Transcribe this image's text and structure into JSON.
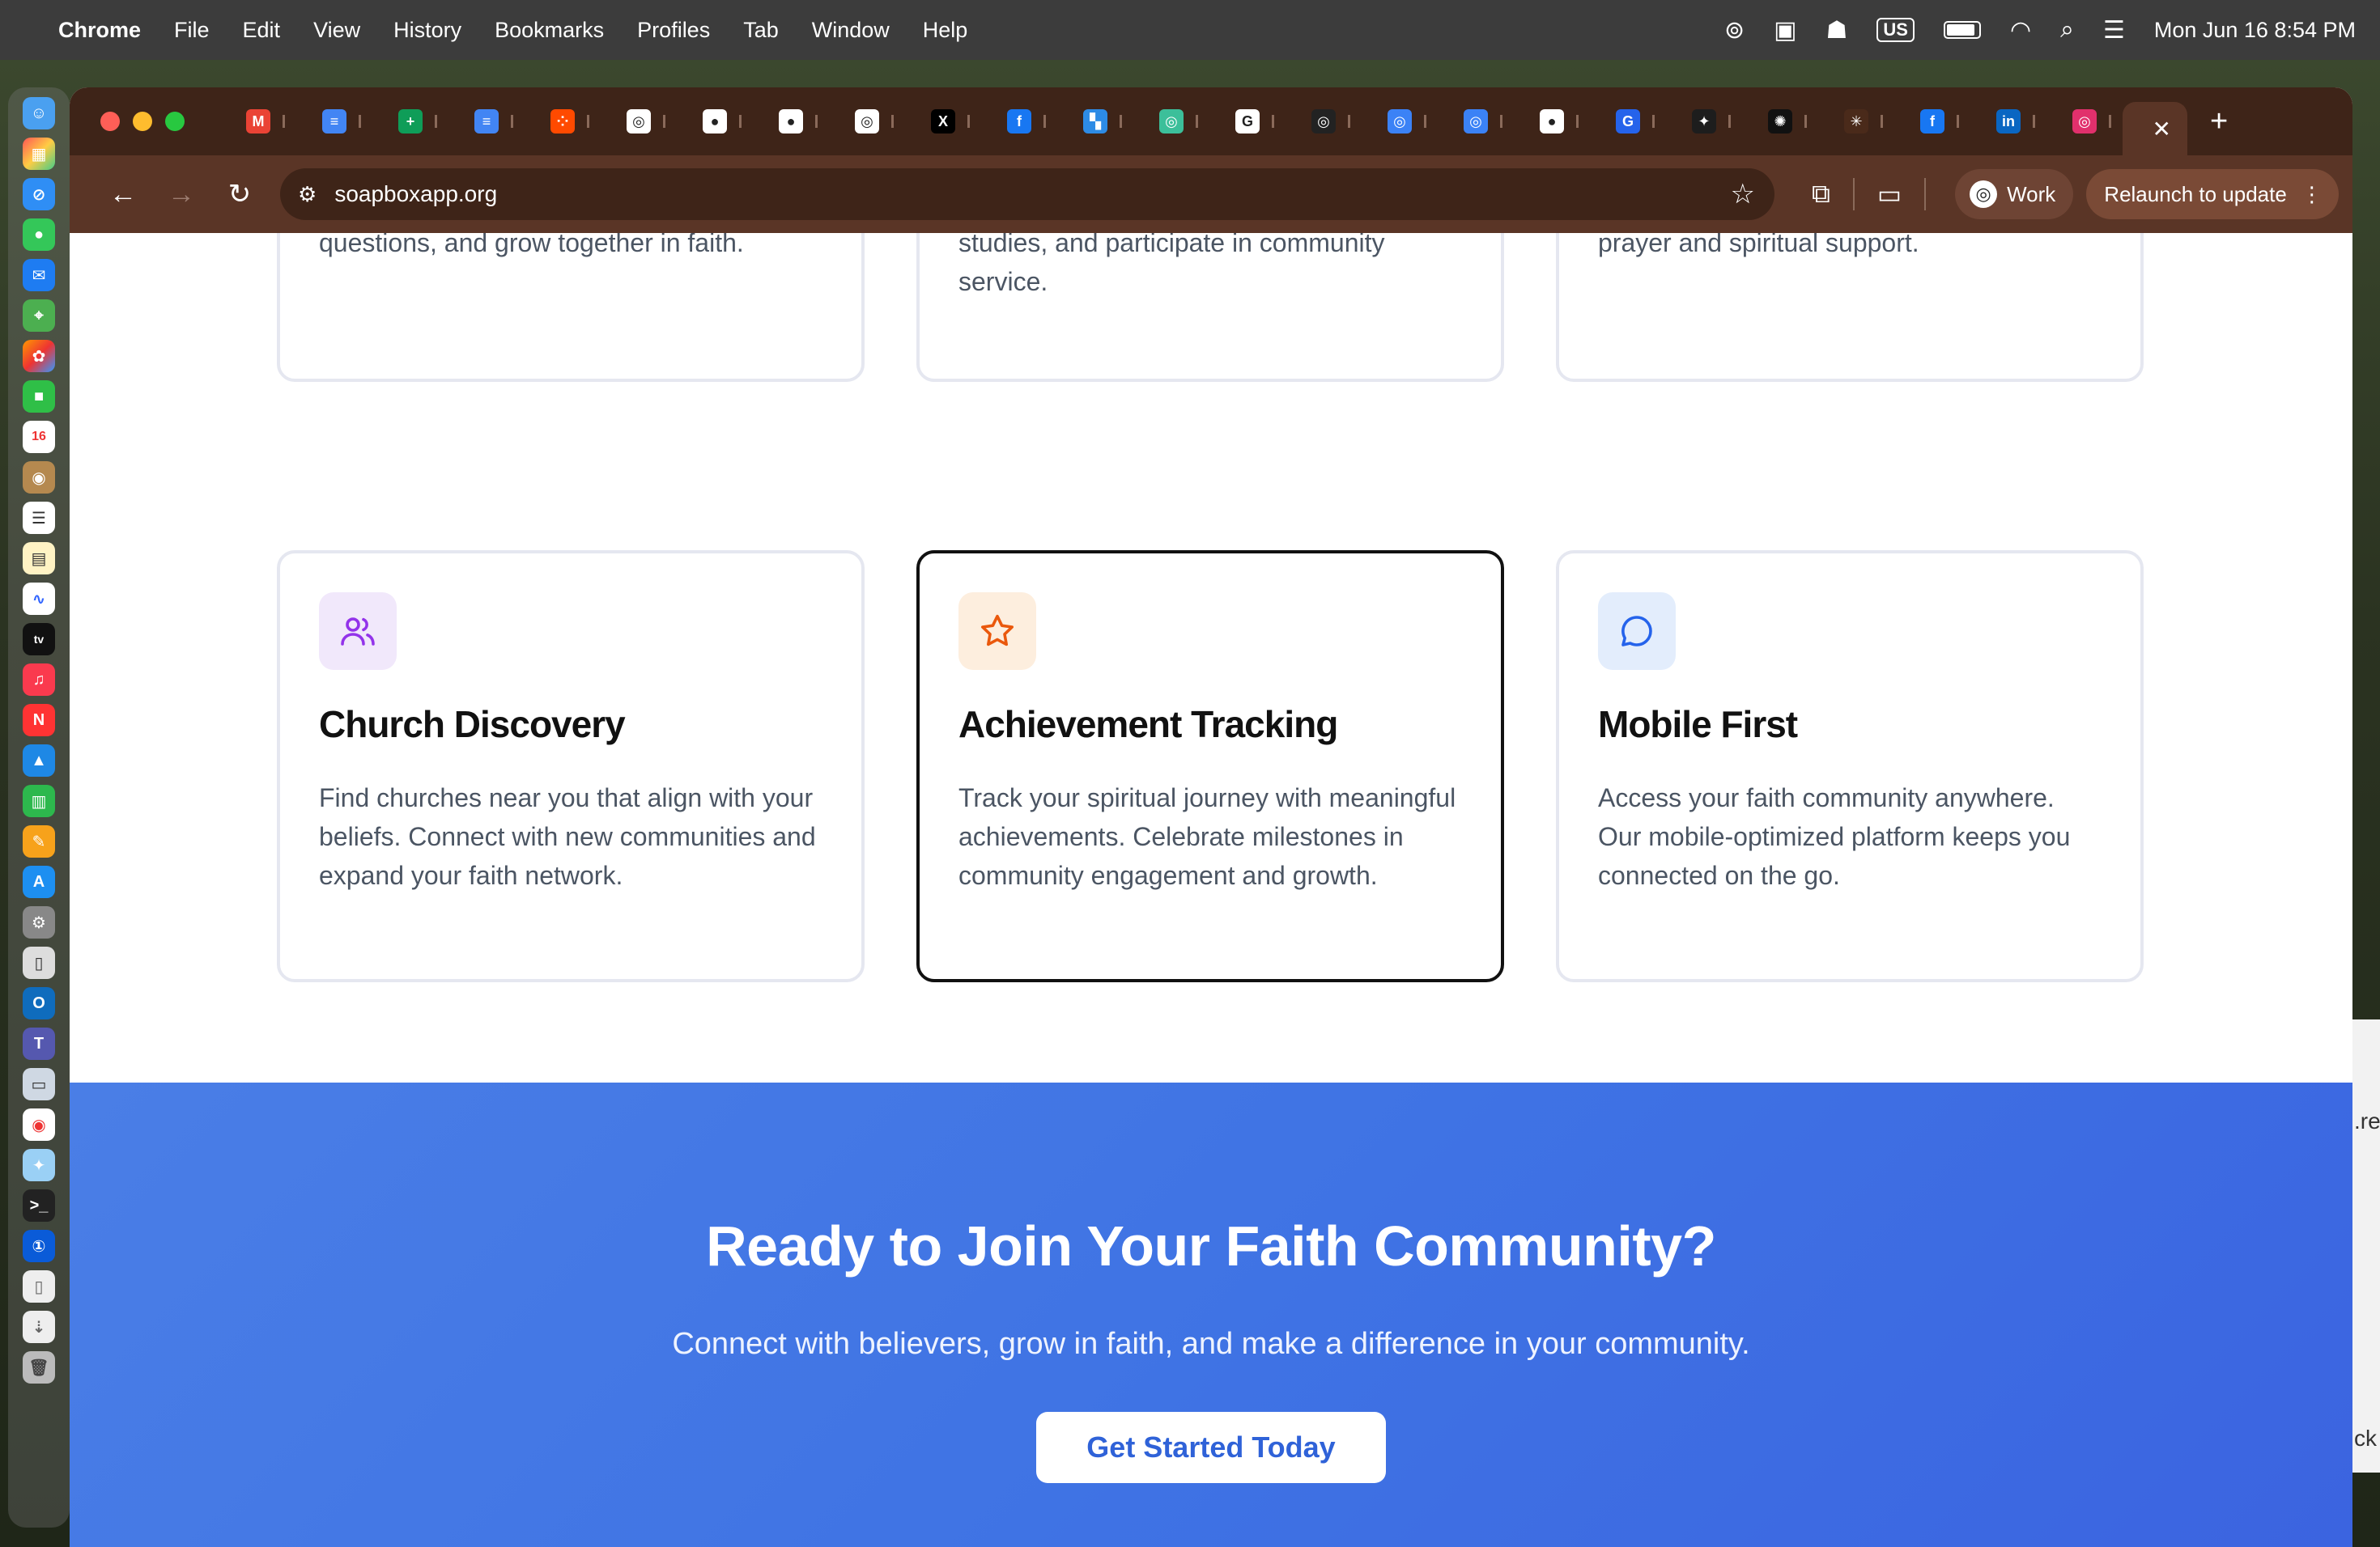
{
  "menubar": {
    "app_name": "Chrome",
    "items": [
      "File",
      "Edit",
      "View",
      "History",
      "Bookmarks",
      "Profiles",
      "Tab",
      "Window",
      "Help"
    ],
    "keyboard": "US",
    "datetime": "Mon Jun 16  8:54 PM"
  },
  "dock": {
    "calendar_day": "16",
    "tv_label": "tv"
  },
  "browser": {
    "url": "soapboxapp.org",
    "profile": "Work",
    "relaunch": "Relaunch to update",
    "tabs": [
      {
        "icon": "gmail-icon",
        "glyph": "M",
        "color": "#ea4335"
      },
      {
        "icon": "docs-icon",
        "glyph": "≡",
        "color": "#4285f4"
      },
      {
        "icon": "sheets-icon",
        "glyph": "+",
        "color": "#0f9d58"
      },
      {
        "icon": "docs-icon",
        "glyph": "≡",
        "color": "#4285f4"
      },
      {
        "icon": "zapier-icon",
        "glyph": "⁘",
        "color": "#ff4a00"
      },
      {
        "icon": "openai-icon",
        "glyph": "◎",
        "color": "#ffffff"
      },
      {
        "icon": "github-icon",
        "glyph": "●",
        "color": "#ffffff"
      },
      {
        "icon": "github-icon",
        "glyph": "●",
        "color": "#ffffff"
      },
      {
        "icon": "openai-icon",
        "glyph": "◎",
        "color": "#ffffff"
      },
      {
        "icon": "x-icon",
        "glyph": "X",
        "color": "#000000"
      },
      {
        "icon": "facebook-icon",
        "glyph": "f",
        "color": "#1877f2"
      },
      {
        "icon": "confluence-icon",
        "glyph": "▚",
        "color": "#2d8be5"
      },
      {
        "icon": "openai-green-icon",
        "glyph": "◎",
        "color": "#3cbf9a"
      },
      {
        "icon": "google-icon",
        "glyph": "G",
        "color": "#ffffff"
      },
      {
        "icon": "openai-icon",
        "glyph": "◎",
        "color": "#222222"
      },
      {
        "icon": "globe-blue-icon",
        "glyph": "◎",
        "color": "#3b82f6"
      },
      {
        "icon": "globe-blue-icon",
        "glyph": "◎",
        "color": "#3b82f6"
      },
      {
        "icon": "github-icon",
        "glyph": "●",
        "color": "#ffffff"
      },
      {
        "icon": "grammarly-icon",
        "glyph": "G",
        "color": "#2563eb"
      },
      {
        "icon": "perplexity-icon",
        "glyph": "✦",
        "color": "#1d1d1d"
      },
      {
        "icon": "sparkle-icon",
        "glyph": "✺",
        "color": "#111111"
      },
      {
        "icon": "claude-icon",
        "glyph": "✳",
        "color": "#4a2a1a"
      },
      {
        "icon": "facebook-icon",
        "glyph": "f",
        "color": "#1877f2"
      },
      {
        "icon": "linkedin-icon",
        "glyph": "in",
        "color": "#0a66c2"
      },
      {
        "icon": "instagram-icon",
        "glyph": "◎",
        "color": "#e1306c"
      }
    ]
  },
  "top_cards": [
    {
      "text": "Engage in meaningful conversations with fellow believers. Share insights, ask questions, and grow together in faith."
    },
    {
      "text": "Stay connected with your church community. RSVP to events, join Bible studies, and participate in community service."
    },
    {
      "text": "Share your prayer needs and pray for others. Experience the power of community prayer and spiritual support."
    }
  ],
  "features": [
    {
      "title": "Church Discovery",
      "text": "Find churches near you that align with your beliefs. Connect with new communities and expand your faith network.",
      "icon": "users-icon",
      "icon_bg": "#f1e8fb",
      "icon_color": "#9333ea"
    },
    {
      "title": "Achievement Tracking",
      "text": "Track your spiritual journey with meaningful achievements. Celebrate milestones in community engagement and growth.",
      "icon": "star-icon",
      "icon_bg": "#fdeede",
      "icon_color": "#ea580c"
    },
    {
      "title": "Mobile First",
      "text": "Access your faith community anywhere. Our mobile-optimized platform keeps you connected on the go.",
      "icon": "message-icon",
      "icon_bg": "#e3edfc",
      "icon_color": "#2563eb"
    }
  ],
  "cta": {
    "title": "Ready to Join Your Faith Community?",
    "subtitle": "Connect with believers, grow in faith, and make a difference in your community.",
    "button": "Get Started Today"
  },
  "side_window": {
    "text_top": ".re",
    "text_bottom": "ck"
  }
}
